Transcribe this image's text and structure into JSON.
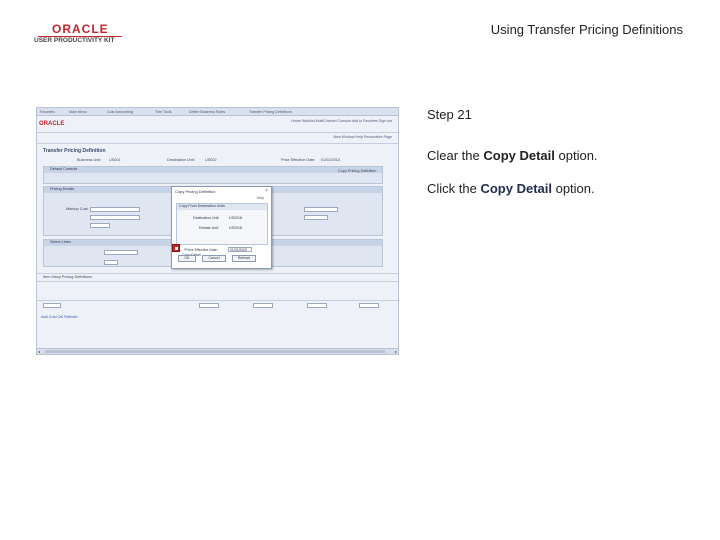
{
  "header": {
    "logo_brand": "ORACLE",
    "logo_sub": "USER PRODUCTIVITY KIT",
    "title": "Using Transfer Pricing Definitions"
  },
  "instructions": {
    "step": "Step 21",
    "line1_prefix": "Clear the ",
    "line1_bold": "Copy Detail",
    "line1_suffix": " option.",
    "line2_prefix": "Click the ",
    "line2_bold": "Copy Detail",
    "line2_suffix": " option."
  },
  "screenshot": {
    "tabs": [
      "Favorites",
      "Main Menu",
      "Cost Accounting",
      "Tree Tools",
      "Define Business Rules",
      "Transfer Pricing Definitions"
    ],
    "top_links": "Home   Worklist   MultiChannel Console   Add to Favorites   Sign out",
    "top_links2": "New Window   Help   Personalize Page",
    "oracle_mini": "ORACLE",
    "page_title": "Transfer Pricing Definition",
    "business_unit_label": "Business Unit:",
    "business_unit_value": "US001",
    "destination_unit_label": "Destination Unit:",
    "destination_unit_value": "US002",
    "effective_date_label": "Price Effective Date:",
    "effective_date_value": "01/02/2010",
    "section_default_controls": "Default Controls",
    "section_pricing_details": "Pricing Details",
    "section_select_lines": "Select Lines",
    "section_many_pricing": "Item Many Pricing Definitions",
    "copy_pricing_label": "Copy Pricing Definition",
    "markup_label": "Markup Cost:",
    "dialog": {
      "title": "Copy Pricing Definition",
      "help": "Help",
      "box_header": "Copy From Destination Units",
      "destination_label": "Destination Unit:",
      "destination_value": "US2018",
      "rebate_label": "Rebate Unit:",
      "rebate_value": "US2018",
      "price_date_label": "*Price Effective Date:",
      "price_date_value": "01/01/2009",
      "copy_detail_label": "Copy Detail",
      "ok_label": "OK",
      "cancel_label": "Cancel",
      "refresh_label": "Refresh"
    },
    "bottom_buttons": "Add Cost   OK   Refresh"
  }
}
